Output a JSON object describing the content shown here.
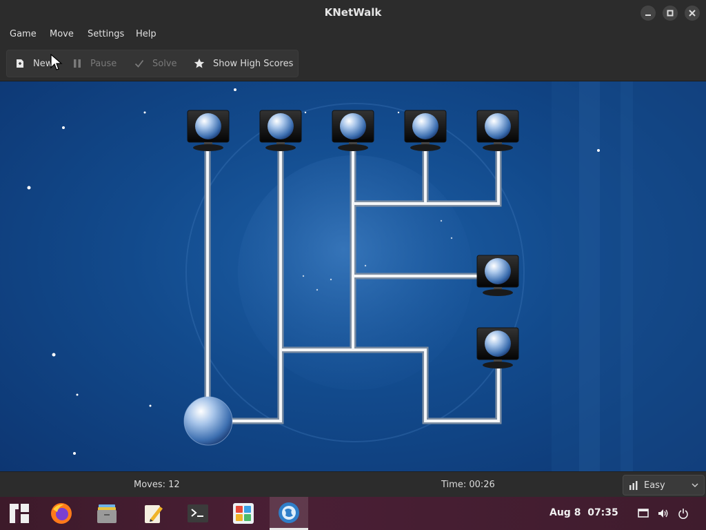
{
  "window": {
    "title": "KNetWalk"
  },
  "menu": {
    "items": [
      "Game",
      "Move",
      "Settings",
      "Help"
    ]
  },
  "toolbar": {
    "new_label": "New",
    "pause_label": "Pause",
    "solve_label": "Solve",
    "scores_label": "Show High Scores"
  },
  "status": {
    "moves": "Moves: 12",
    "time": "Time: 00:26",
    "difficulty": "Easy"
  },
  "taskbar": {
    "apps": [
      "manjaro-menu-icon",
      "firefox-icon",
      "file-manager-icon",
      "text-editor-icon",
      "terminal-icon",
      "software-store-icon",
      "knetwalk-icon"
    ],
    "active_app": "knetwalk-icon",
    "date": "Aug 8",
    "time": "07:35"
  },
  "colors": {
    "board_bg": "#124a8c",
    "window_bg": "#2c2c2c",
    "taskbar_bg": "#4a1f35"
  }
}
